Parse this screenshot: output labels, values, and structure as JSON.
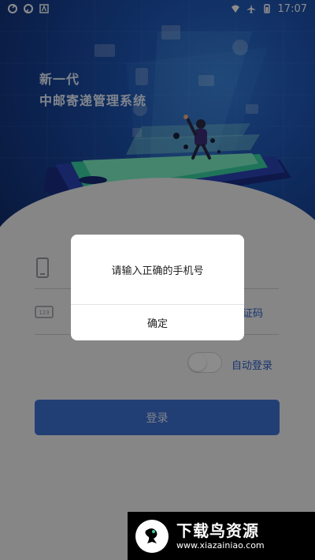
{
  "status_bar": {
    "time": "17:07",
    "left_icons": [
      "sync-icon",
      "sync-icon",
      "app-a-icon"
    ],
    "right_icons": [
      "wifi-icon",
      "airplane-icon",
      "battery-icon"
    ]
  },
  "hero": {
    "title_line1": "新一代",
    "title_line2": "中邮寄递管理系统"
  },
  "form": {
    "verification_link": "证码",
    "auto_login_label": "自动登录",
    "login_button": "登录"
  },
  "dialog": {
    "message": "请输入正确的手机号",
    "ok_button": "确定"
  },
  "watermark": {
    "title": "下载鸟资源",
    "url": "www.xiazainiao.com"
  },
  "colors": {
    "hero_bg": "#1f56b5",
    "accent": "#2a61c7",
    "login_bg": "#3f73d6",
    "overlay": "rgba(0,0,0,0.45)"
  }
}
